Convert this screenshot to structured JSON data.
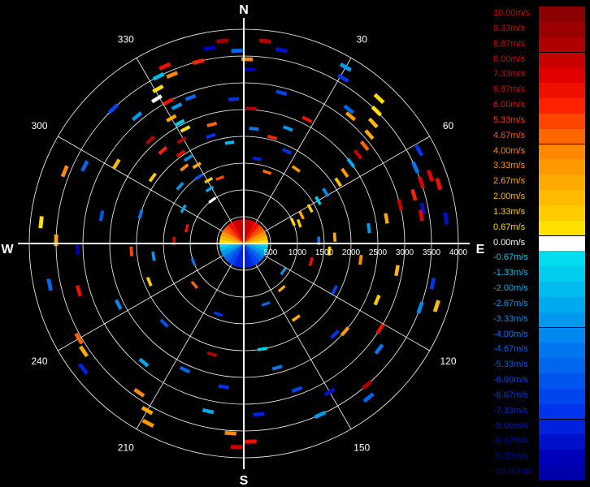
{
  "chart_data": {
    "type": "polar-scatter",
    "cardinals": {
      "north": "N",
      "east": "E",
      "south": "S",
      "west": "W"
    },
    "azimuth_labels": [
      "30",
      "60",
      "120",
      "150",
      "210",
      "240",
      "300",
      "330"
    ],
    "azimuths": [
      30,
      60,
      120,
      150,
      210,
      240,
      300,
      330
    ],
    "range_labels": [
      "500",
      "1000",
      "1500",
      "2000",
      "2500",
      "3000",
      "3500",
      "4000"
    ],
    "range_values": [
      500,
      1000,
      1500,
      2000,
      2500,
      3000,
      3500,
      4000
    ],
    "range_max": 4000,
    "grid": true,
    "legend_position": "right",
    "colorbar": {
      "labels": [
        "10.00m/s",
        "9.33m/s",
        "8.67m/s",
        "8.00m/s",
        "7.33m/s",
        "6.67m/s",
        "6.00m/s",
        "5.33m/s",
        "4.67m/s",
        "4.00m/s",
        "3.33m/s",
        "2.67m/s",
        "2.00m/s",
        "1.33m/s",
        "0.67m/s",
        "0.00m/s",
        "-0.67m/s",
        "-1.33m/s",
        "-2.00m/s",
        "-2.67m/s",
        "-3.33m/s",
        "-4.00m/s",
        "-4.67m/s",
        "-5.33m/s",
        "-6.00m/s",
        "-6.67m/s",
        "-7.33m/s",
        "-8.00m/s",
        "-8.67m/s",
        "-9.33m/s",
        "-10.00m/s"
      ],
      "colors": [
        "#8b0000",
        "#9a0000",
        "#b00000",
        "#c80000",
        "#e00000",
        "#f01000",
        "#ff2200",
        "#ff4400",
        "#ff6600",
        "#ff8800",
        "#ff9900",
        "#ffaa00",
        "#ffbb00",
        "#ffcc00",
        "#ffe000",
        "#ffffff",
        "#00ddee",
        "#00ccee",
        "#00bbee",
        "#00aaee",
        "#0099ee",
        "#0088ee",
        "#0077ee",
        "#0066ee",
        "#0055ee",
        "#0044ee",
        "#0033ee",
        "#0022dd",
        "#0011cc",
        "#0000bb",
        "#0000aa"
      ],
      "label_colors": [
        "#d00000",
        "#d00000",
        "#d00000",
        "#d00000",
        "#d00000",
        "#d00000",
        "#e01000",
        "#ff3300",
        "#ff5500",
        "#ff8800",
        "#ff9900",
        "#ffaa00",
        "#ffbb00",
        "#ffcc00",
        "#ffdd00",
        "#ffffff",
        "#00ccee",
        "#00bbee",
        "#00aaee",
        "#0099ee",
        "#0088ee",
        "#0077ee",
        "#0066ee",
        "#0055ee",
        "#0044ee",
        "#0033ee",
        "#0022dd",
        "#0011cc",
        "#0000bb",
        "#0000aa",
        "#000099"
      ]
    },
    "points": [
      {
        "az": 336,
        "r": 3620,
        "v": 6.5
      },
      {
        "az": 337,
        "r": 3420,
        "v": 4.0
      },
      {
        "az": 333,
        "r": 3500,
        "v": -2.0
      },
      {
        "az": 331,
        "r": 3300,
        "v": 1.0
      },
      {
        "az": 329,
        "r": 3150,
        "v": 0.0
      },
      {
        "az": 332,
        "r": 3000,
        "v": 7.0
      },
      {
        "az": 334,
        "r": 2850,
        "v": -3.0
      },
      {
        "az": 330,
        "r": 2700,
        "v": 2.5
      },
      {
        "az": 332,
        "r": 2550,
        "v": -1.5
      },
      {
        "az": 333,
        "r": 2400,
        "v": 0.5
      },
      {
        "az": 329,
        "r": 2250,
        "v": 8.5
      },
      {
        "az": 325,
        "r": 2050,
        "v": 7.5
      },
      {
        "az": 327,
        "r": 1900,
        "v": -4.0
      },
      {
        "az": 329,
        "r": 1700,
        "v": 3.0
      },
      {
        "az": 326,
        "r": 1500,
        "v": -6.0
      },
      {
        "az": 331,
        "r": 1350,
        "v": 1.5
      },
      {
        "az": 328,
        "r": 1200,
        "v": -2.5
      },
      {
        "az": 324,
        "r": 1000,
        "v": 0.0
      },
      {
        "az": 320,
        "r": 3100,
        "v": -3.5
      },
      {
        "az": 318,
        "r": 2600,
        "v": 9.0
      },
      {
        "az": 343,
        "r": 2100,
        "v": -7.0
      },
      {
        "az": 346,
        "r": 3500,
        "v": 6.0
      },
      {
        "az": 350,
        "r": 3700,
        "v": -9.0
      },
      {
        "az": 354,
        "r": 3800,
        "v": 9.5
      },
      {
        "az": 358,
        "r": 3600,
        "v": -5.0
      },
      {
        "az": 6,
        "r": 3800,
        "v": 9.0
      },
      {
        "az": 1,
        "r": 3440,
        "v": 4.0
      },
      {
        "az": 2,
        "r": 3250,
        "v": -9.5
      },
      {
        "az": 3,
        "r": 2520,
        "v": 9.0
      },
      {
        "az": 5,
        "r": 2150,
        "v": -4.5
      },
      {
        "az": 11,
        "r": 3680,
        "v": -8.5
      },
      {
        "az": 14,
        "r": 2900,
        "v": -6.5
      },
      {
        "az": 15,
        "r": 2050,
        "v": 6.0
      },
      {
        "az": 21,
        "r": 2300,
        "v": -3.5
      },
      {
        "az": 25,
        "r": 1900,
        "v": -7.5
      },
      {
        "az": 27,
        "r": 2600,
        "v": 6.5
      },
      {
        "az": 30,
        "r": 3800,
        "v": -3.0
      },
      {
        "az": 31,
        "r": 3600,
        "v": -7.0
      },
      {
        "az": 38,
        "r": 3180,
        "v": -5.5
      },
      {
        "az": 40,
        "r": 3100,
        "v": 3.5
      },
      {
        "az": 43,
        "r": 3700,
        "v": 1.0
      },
      {
        "az": 45,
        "r": 3500,
        "v": 0.8
      },
      {
        "az": 47,
        "r": 3300,
        "v": 2.0
      },
      {
        "az": 49,
        "r": 3100,
        "v": 3.0
      },
      {
        "az": 51,
        "r": 2900,
        "v": 5.0
      },
      {
        "az": 52,
        "r": 2700,
        "v": 8.0
      },
      {
        "az": 53,
        "r": 2500,
        "v": -2.5
      },
      {
        "az": 55,
        "r": 2300,
        "v": 3.5
      },
      {
        "az": 57,
        "r": 2100,
        "v": 2.0
      },
      {
        "az": 58,
        "r": 1800,
        "v": -4.0
      },
      {
        "az": 60,
        "r": 1600,
        "v": -1.0
      },
      {
        "az": 62,
        "r": 1400,
        "v": 1.5
      },
      {
        "az": 64,
        "r": 1200,
        "v": 2.5
      },
      {
        "az": 66,
        "r": 1000,
        "v": 0.5
      },
      {
        "az": 62,
        "r": 3700,
        "v": -7.5
      },
      {
        "az": 66,
        "r": 3500,
        "v": -4.5
      },
      {
        "az": 70,
        "r": 3700,
        "v": 7.5
      },
      {
        "az": 73,
        "r": 3800,
        "v": 6.5
      },
      {
        "az": 71,
        "r": 3500,
        "v": 7.5
      },
      {
        "az": 74,
        "r": 3300,
        "v": 6.0
      },
      {
        "az": 76,
        "r": 3000,
        "v": 8.0
      },
      {
        "az": 79,
        "r": 3400,
        "v": -8.5
      },
      {
        "az": 81,
        "r": 3350,
        "v": 7.5
      },
      {
        "az": 83,
        "r": 3800,
        "v": -8.5
      },
      {
        "az": 80,
        "r": 2700,
        "v": 2.5
      },
      {
        "az": 83,
        "r": 2350,
        "v": -3.0
      },
      {
        "az": 86,
        "r": 1700,
        "v": 3.0
      },
      {
        "az": 88,
        "r": 1400,
        "v": -4.5
      },
      {
        "az": 95,
        "r": 1600,
        "v": 1.5
      },
      {
        "az": 98,
        "r": 2200,
        "v": 4.0
      },
      {
        "az": 100,
        "r": 2900,
        "v": 1.8
      },
      {
        "az": 102,
        "r": 3600,
        "v": -7.0
      },
      {
        "az": 108,
        "r": 3780,
        "v": 2.2
      },
      {
        "az": 110,
        "r": 3500,
        "v": -4.0
      },
      {
        "az": 113,
        "r": 2700,
        "v": 1.5
      },
      {
        "az": 117,
        "r": 1900,
        "v": -6.5
      },
      {
        "az": 122,
        "r": 3000,
        "v": 6.5
      },
      {
        "az": 128,
        "r": 3200,
        "v": -4.5
      },
      {
        "az": 131,
        "r": 2500,
        "v": 3.5
      },
      {
        "az": 135,
        "r": 2400,
        "v": -7.5
      },
      {
        "az": 139,
        "r": 3500,
        "v": 8.5
      },
      {
        "az": 141,
        "r": 3700,
        "v": -5.0
      },
      {
        "az": 145,
        "r": 1700,
        "v": 3.0
      },
      {
        "az": 150,
        "r": 3200,
        "v": -8.5
      },
      {
        "az": 156,
        "r": 3500,
        "v": -3.0
      },
      {
        "az": 160,
        "r": 2900,
        "v": -6.5
      },
      {
        "az": 165,
        "r": 2400,
        "v": -4.5
      },
      {
        "az": 170,
        "r": 2000,
        "v": -1.5
      },
      {
        "az": 175,
        "r": 3200,
        "v": -8.0
      },
      {
        "az": 178,
        "r": 3700,
        "v": 6.5
      },
      {
        "az": 182,
        "r": 3800,
        "v": 8.0
      },
      {
        "az": 184,
        "r": 3550,
        "v": 4.0
      },
      {
        "az": 188,
        "r": 2700,
        "v": -7.5
      },
      {
        "az": 192,
        "r": 3200,
        "v": -2.5
      },
      {
        "az": 196,
        "r": 2150,
        "v": 8.5
      },
      {
        "az": 205,
        "r": 2600,
        "v": -5.5
      },
      {
        "az": 208,
        "r": 3800,
        "v": 3.5
      },
      {
        "az": 210,
        "r": 3600,
        "v": 2.5
      },
      {
        "az": 215,
        "r": 3400,
        "v": 4.0
      },
      {
        "az": 220,
        "r": 2900,
        "v": -2.5
      },
      {
        "az": 225,
        "r": 2100,
        "v": -6.0
      },
      {
        "az": 232,
        "r": 3800,
        "v": -8.0
      },
      {
        "az": 236,
        "r": 3600,
        "v": 2.8
      },
      {
        "az": 240,
        "r": 3550,
        "v": 4.5
      },
      {
        "az": 244,
        "r": 2600,
        "v": -4.0
      },
      {
        "az": 248,
        "r": 1900,
        "v": 1.5
      },
      {
        "az": 254,
        "r": 3200,
        "v": 7.0
      },
      {
        "az": 258,
        "r": 3700,
        "v": -5.5
      },
      {
        "az": 262,
        "r": 1700,
        "v": -3.0
      },
      {
        "az": 266,
        "r": 2100,
        "v": 5.5
      },
      {
        "az": 268,
        "r": 3100,
        "v": -9.0
      },
      {
        "az": 271,
        "r": 3500,
        "v": 2.5
      },
      {
        "az": 272,
        "r": 1300,
        "v": 7.5
      },
      {
        "az": 276,
        "r": 3800,
        "v": 0.8
      },
      {
        "az": 281,
        "r": 2700,
        "v": -6.0
      },
      {
        "az": 286,
        "r": 2000,
        "v": -4.5
      },
      {
        "az": 292,
        "r": 3600,
        "v": 4.0
      },
      {
        "az": 296,
        "r": 3300,
        "v": -5.0
      },
      {
        "az": 302,
        "r": 2800,
        "v": 2.2
      },
      {
        "az": 306,
        "r": 2100,
        "v": 1.2
      },
      {
        "az": 312,
        "r": 1600,
        "v": -3.5
      },
      {
        "az": 316,
        "r": 3500,
        "v": -6.5
      },
      {
        "az": 319,
        "r": 2300,
        "v": 6.0
      },
      {
        "az": 322,
        "r": 1800,
        "v": 4.0
      },
      {
        "az": 340,
        "r": 2900,
        "v": -5.5
      },
      {
        "az": 345,
        "r": 2300,
        "v": 4.5
      },
      {
        "az": 352,
        "r": 1900,
        "v": -2.0
      },
      {
        "az": 356,
        "r": 2700,
        "v": -7.0
      },
      {
        "az": 9,
        "r": 1600,
        "v": -8.0
      },
      {
        "az": 18,
        "r": 1400,
        "v": 5.0
      },
      {
        "az": 35,
        "r": 1700,
        "v": 3.5
      },
      {
        "az": 70,
        "r": 1100,
        "v": 1.5
      },
      {
        "az": 105,
        "r": 1300,
        "v": 7.0
      },
      {
        "az": 125,
        "r": 900,
        "v": -3.5
      },
      {
        "az": 140,
        "r": 1100,
        "v": 3.0
      },
      {
        "az": 160,
        "r": 1200,
        "v": -5.0
      },
      {
        "az": 200,
        "r": 1400,
        "v": -7.5
      },
      {
        "az": 230,
        "r": 1200,
        "v": 4.5
      },
      {
        "az": 250,
        "r": 1000,
        "v": -4.5
      },
      {
        "az": 285,
        "r": 1100,
        "v": 6.5
      },
      {
        "az": 300,
        "r": 1300,
        "v": -2.5
      },
      {
        "az": 340,
        "r": 1300,
        "v": 5.5
      }
    ]
  }
}
